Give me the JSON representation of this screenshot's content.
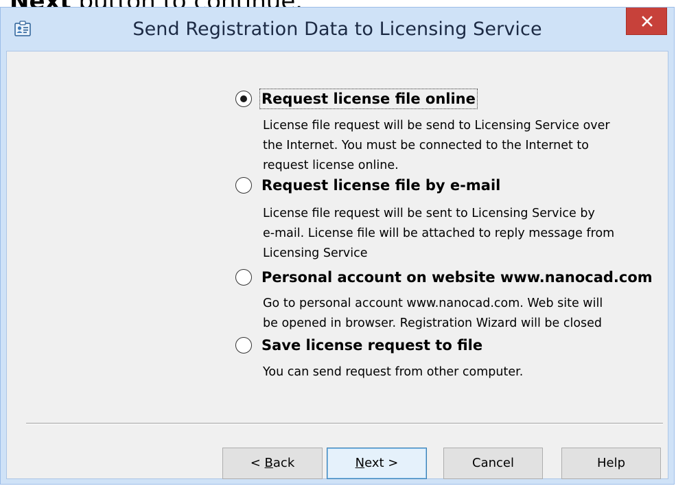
{
  "background_caption": {
    "bold": "Next",
    "rest": " button to continue."
  },
  "window": {
    "title": "Send Registration Data to Licensing Service",
    "icon": "registration-card-icon",
    "close_glyph": "×"
  },
  "options": [
    {
      "label": "Request license file online",
      "selected": true,
      "description": [
        "License file request will be send to Licensing Service over",
        "the Internet. You must be connected to the Internet to",
        "request license online."
      ]
    },
    {
      "label": "Request license file by e-mail",
      "selected": false,
      "description": [
        "License file request will be sent to Licensing Service by",
        "e-mail. License file will be attached to reply message from",
        "Licensing Service"
      ]
    },
    {
      "label": "Personal account on website www.nanocad.com",
      "selected": false,
      "description": [
        "Go to personal account www.nanocad.com. Web site will",
        "be opened in browser. Registration Wizard will be closed"
      ]
    },
    {
      "label": "Save license request to file",
      "selected": false,
      "description": [
        "You can send request from other computer."
      ]
    }
  ],
  "buttons": {
    "back": {
      "prefix": "< ",
      "accel": "B",
      "rest": "ack"
    },
    "next": {
      "accel": "N",
      "rest": "ext >"
    },
    "cancel": "Cancel",
    "help": "Help"
  },
  "colors": {
    "frame": "#cfe2f7",
    "close_button": "#c7413a",
    "dialog_body": "#f0f0f0",
    "default_button_border": "#3c7fb1"
  }
}
